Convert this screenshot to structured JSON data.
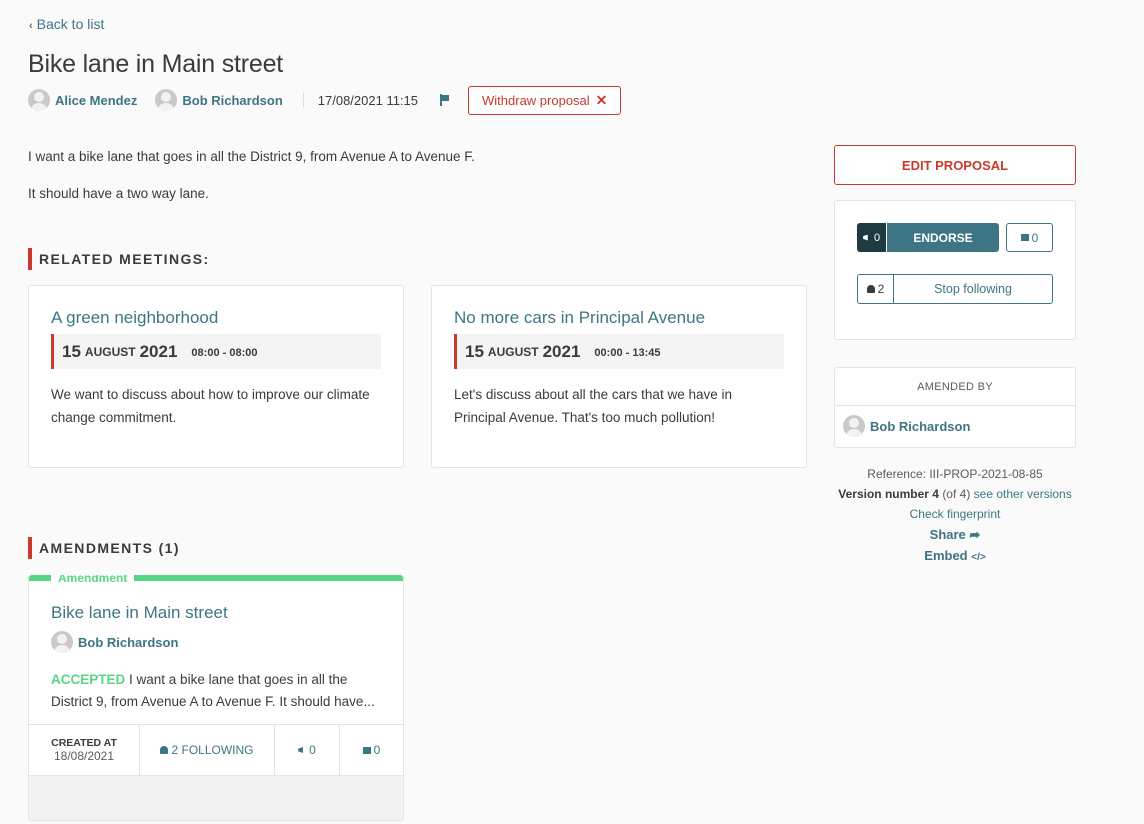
{
  "nav": {
    "back_label": "Back to list"
  },
  "proposal": {
    "title": "Bike lane in Main street",
    "authors": [
      "Alice Mendez",
      "Bob Richardson"
    ],
    "date": "17/08/2021 11:15",
    "withdraw_label": "Withdraw proposal",
    "body": [
      "I want a bike lane that goes in all the District 9, from Avenue A to Avenue F.",
      "It should have a two way lane."
    ]
  },
  "related_meetings": {
    "heading": "Related meetings:",
    "items": [
      {
        "title": "A green neighborhood",
        "day": "15",
        "month": "August",
        "year": "2021",
        "time": "08:00 - 08:00",
        "description": "We want to discuss about how to improve our climate change commitment."
      },
      {
        "title": "No more cars in Principal Avenue",
        "day": "15",
        "month": "August",
        "year": "2021",
        "time": "00:00 - 13:45",
        "description": "Let's discuss about all the cars that we have in Principal Avenue. That's too much pollution!"
      }
    ]
  },
  "amendments": {
    "heading": "Amendments (1)",
    "items": [
      {
        "label": "Amendment",
        "title": "Bike lane in Main street",
        "author": "Bob Richardson",
        "status": "ACCEPTED",
        "excerpt": "I want a bike lane that goes in all the District 9, from Avenue A to Avenue F. It should have...",
        "created_label": "CREATED AT",
        "created_date": "18/08/2021",
        "following": "2 FOLLOWING",
        "endorsements": "0",
        "comments": "0"
      }
    ]
  },
  "sidebar": {
    "edit_label": "EDIT PROPOSAL",
    "endorse_count": "0",
    "endorse_label": "ENDORSE",
    "comments_count": "0",
    "followers_count": "2",
    "follow_label": "Stop following",
    "amended_by_label": "AMENDED BY",
    "amended_by": "Bob Richardson",
    "reference": "Reference: III-PROP-2021-08-85",
    "version_label": "Version number 4",
    "version_of": "(of 4)",
    "versions_link": "see other versions",
    "fingerprint_link": "Check fingerprint",
    "share_label": "Share",
    "embed_label": "Embed"
  },
  "colors": {
    "accent": "#c93a2c",
    "link": "#3e7584",
    "success": "#57d685"
  }
}
